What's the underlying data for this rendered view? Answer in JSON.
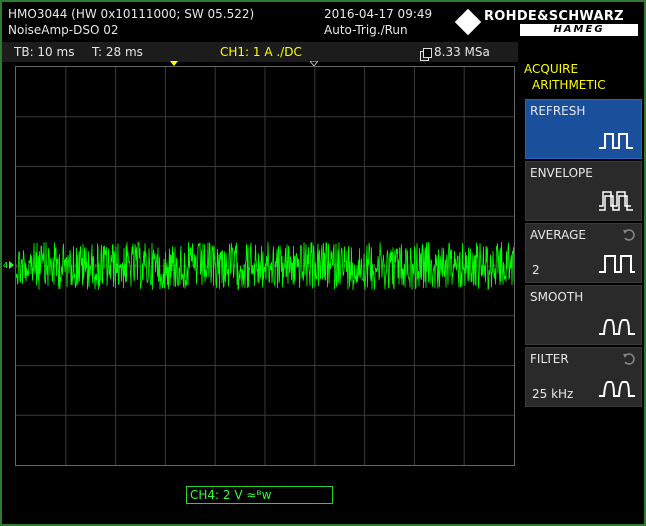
{
  "header": {
    "model": "HMO3044 (HW 0x10111000; SW 05.522)",
    "device_name": "NoiseAmp-DSO 02",
    "datetime": "2016-04-17 09:49",
    "trigger_mode": "Auto-Trig./Run",
    "brand": "ROHDE&SCHWARZ",
    "sub_brand": "HAMEG"
  },
  "info_bar": {
    "timebase": "TB: 10 ms",
    "trigger_time": "T: 28 ms",
    "channel1": "CH1: 1 A ./DC",
    "sample_rate": "8.33 MSa"
  },
  "side_menu": {
    "title_line1": "ACQUIRE",
    "title_line2": "ARITHMETIC",
    "items": [
      {
        "label": "REFRESH",
        "value": "",
        "active": true
      },
      {
        "label": "ENVELOPE",
        "value": "",
        "active": false
      },
      {
        "label": "AVERAGE",
        "value": "2",
        "active": false
      },
      {
        "label": "SMOOTH",
        "value": "",
        "active": false
      },
      {
        "label": "FILTER",
        "value": "25 kHz",
        "active": false
      }
    ]
  },
  "bottom": {
    "channel4": "CH4: 2 V ≈ᴮᴡ"
  },
  "colors": {
    "trace": "#00ff00",
    "channel1": "#ffff00",
    "active_menu": "#1a4f9c"
  }
}
